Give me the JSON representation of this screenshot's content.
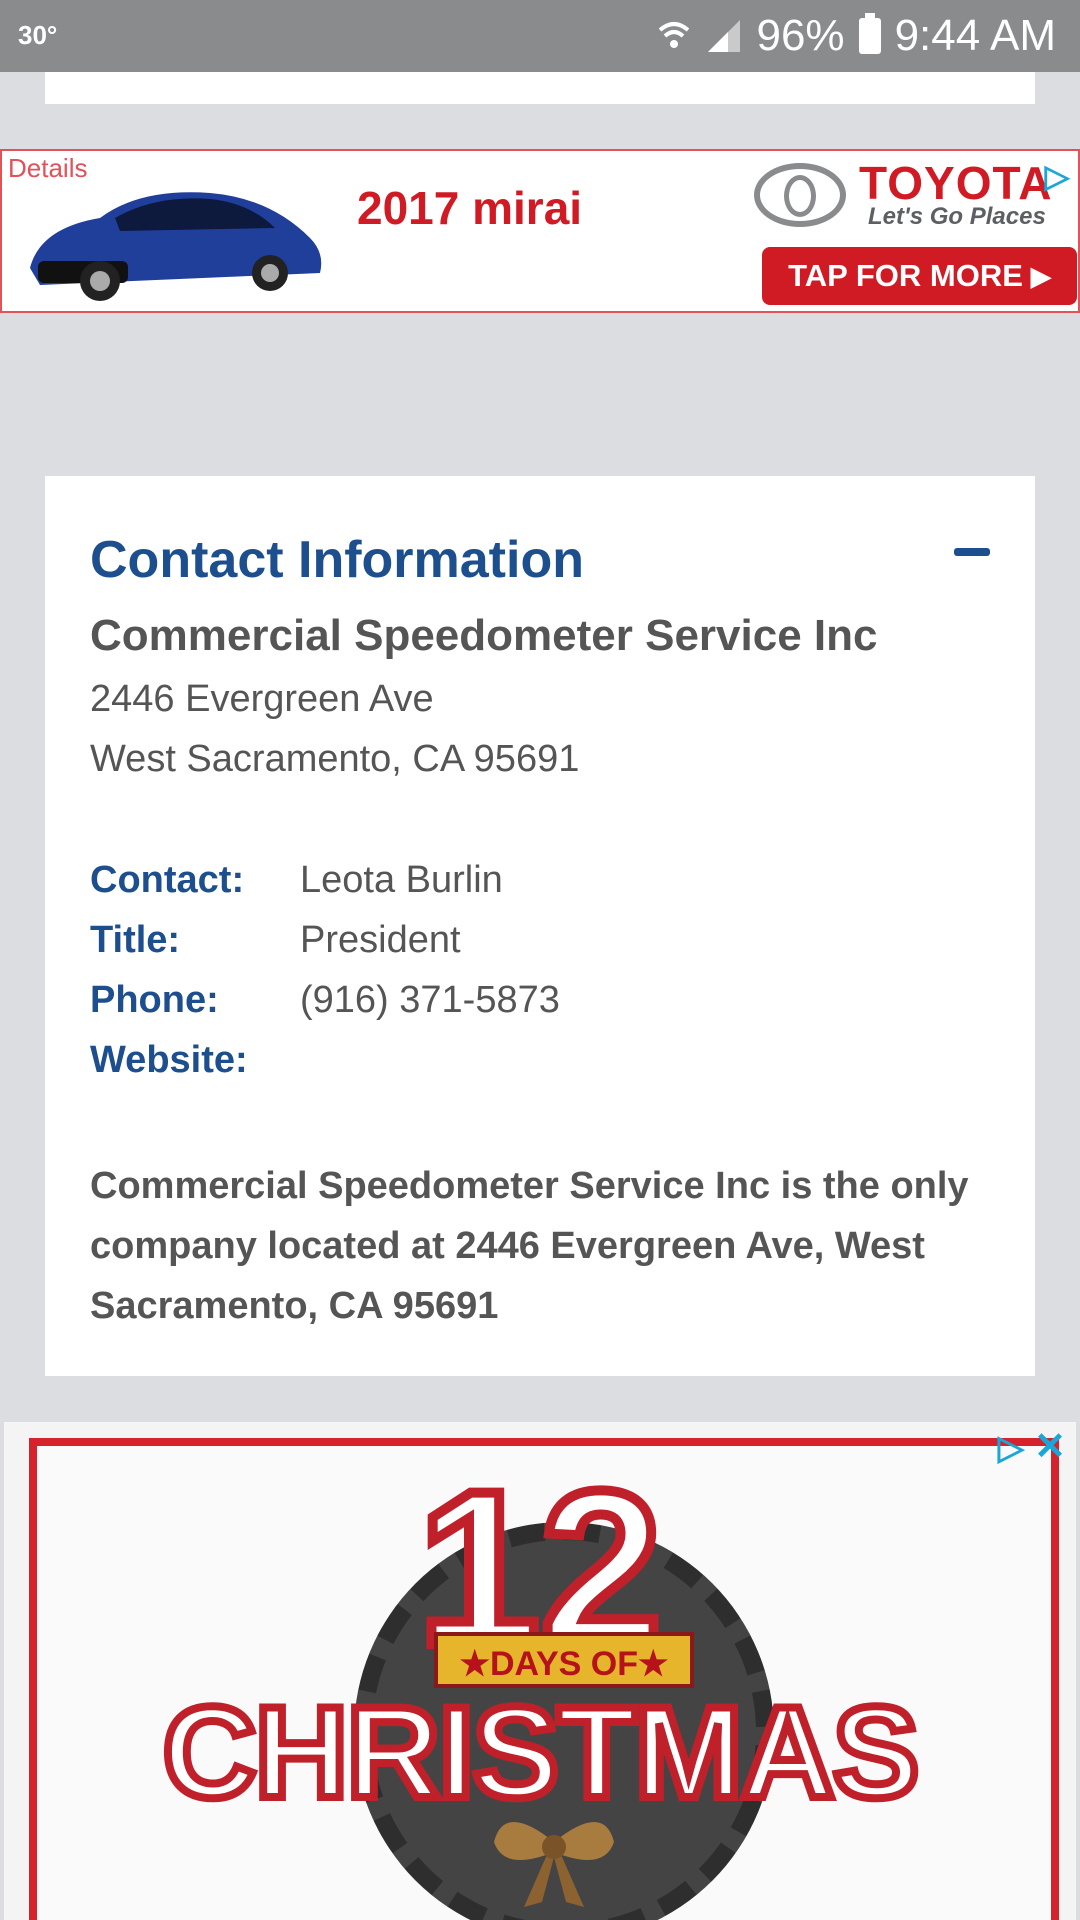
{
  "status_bar": {
    "temperature": "30°",
    "battery": "96%",
    "time": "9:44 AM"
  },
  "toyota_ad": {
    "details_label": "Details",
    "headline": "2017 mirai",
    "brand": "TOYOTA",
    "tagline": "Let's Go Places",
    "cta": "TAP FOR MORE",
    "icons": [
      "car-image",
      "toyota-emblem-icon",
      "adchoices-icon"
    ]
  },
  "contact": {
    "title": "Contact Information",
    "company": "Commercial Speedometer Service Inc",
    "address_line1": "2446 Evergreen Ave",
    "address_line2": "West Sacramento, CA 95691",
    "rows": [
      {
        "label": "Contact:",
        "value": "Leota Burlin"
      },
      {
        "label": "Title:",
        "value": "President"
      },
      {
        "label": "Phone:",
        "value": "(916) 371-5873"
      },
      {
        "label": "Website:",
        "value": ""
      }
    ],
    "description": "Commercial Speedometer Service Inc is the only company located at 2446 Evergreen Ave, West Sacramento, CA 95691"
  },
  "christmas_ad": {
    "number": "12",
    "banner": "★DAYS OF★",
    "word": "CHRISTMAS"
  },
  "colors": {
    "accent_blue": "#1d4f8f",
    "ad_red": "#d11b24",
    "adchoices_blue": "#1aa7d8",
    "page_bg": "#dcdde0"
  }
}
